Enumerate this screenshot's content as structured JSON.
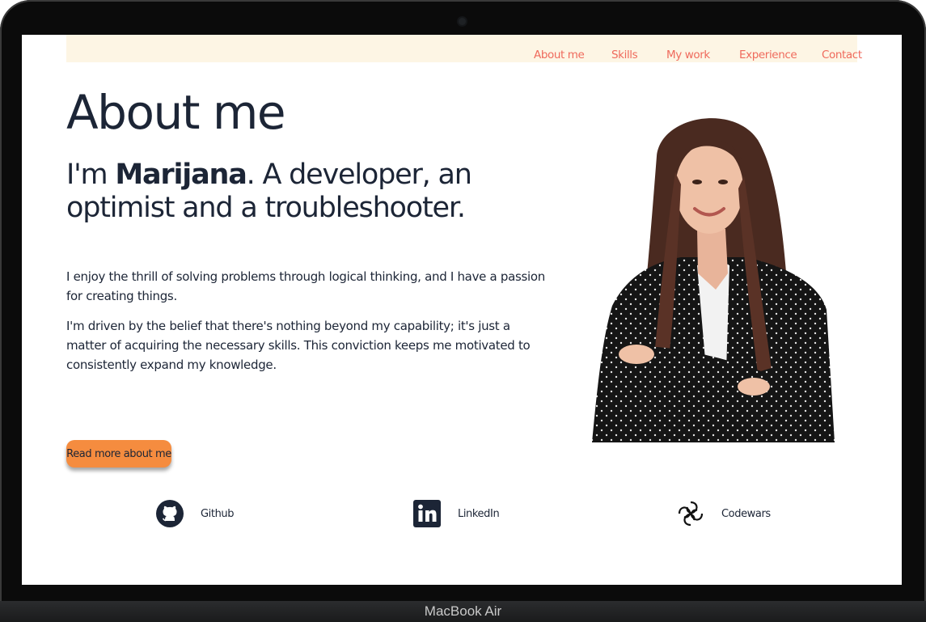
{
  "device": {
    "brand": "MacBook Air"
  },
  "nav": {
    "items": [
      {
        "label": "About me"
      },
      {
        "label": "Skills"
      },
      {
        "label": "My work"
      },
      {
        "label": "Experience"
      },
      {
        "label": "Contact"
      }
    ],
    "color": "#ef6a5c",
    "background": "#fdf5e4"
  },
  "hero": {
    "title": "About me",
    "tagline_prefix": "I'm ",
    "name": "Marijana",
    "tagline_suffix": ". A developer, an optimist and a troubleshooter.",
    "paragraphs": [
      "I enjoy the thrill of solving problems through logical thinking, and I have a passion for creating things.",
      "I'm driven by the belief that there's nothing beyond my capability; it's just a matter of acquiring the necessary skills. This conviction keeps me motivated to consistently expand my knowledge."
    ],
    "cta_label": "Read more about me",
    "cta_color": "#f58c3f",
    "text_color": "#1c2536"
  },
  "social": [
    {
      "icon": "github-icon",
      "label": "Github"
    },
    {
      "icon": "linkedin-icon",
      "label": "LinkedIn"
    },
    {
      "icon": "codewars-icon",
      "label": "Codewars"
    }
  ]
}
